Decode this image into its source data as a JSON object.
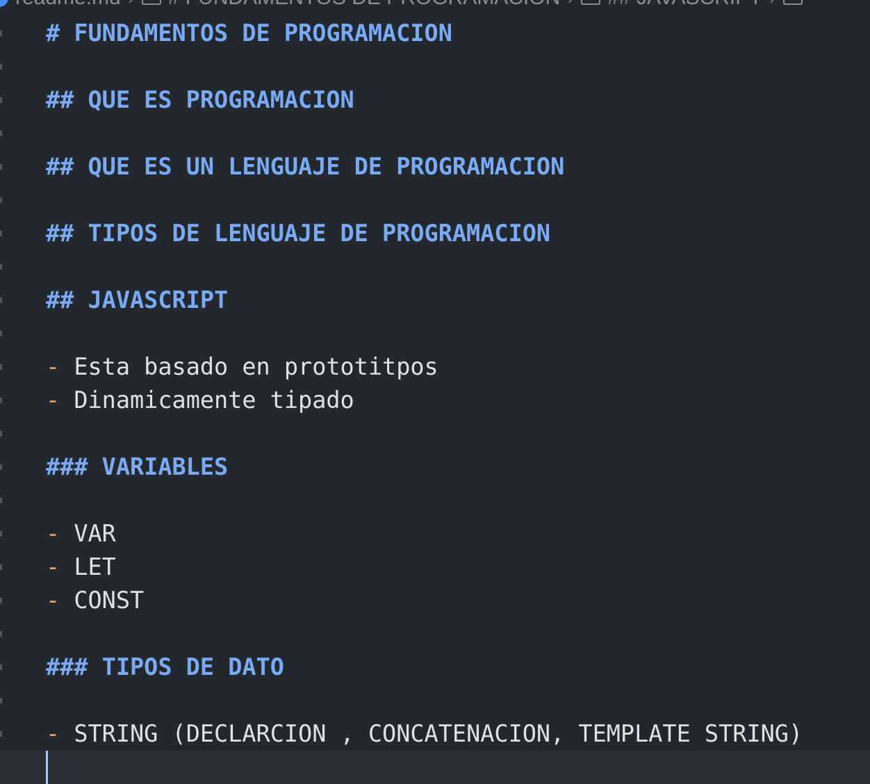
{
  "breadcrumb": {
    "file": "readme.md",
    "items": [
      "# FUNDAMENTOS DE PROGRAMACION",
      "## JAVASCRIPT"
    ]
  },
  "lines": [
    {
      "type": "heading",
      "text": "# FUNDAMENTOS DE PROGRAMACION"
    },
    {
      "type": "empty",
      "text": ""
    },
    {
      "type": "heading",
      "text": "## QUE ES PROGRAMACION"
    },
    {
      "type": "empty",
      "text": ""
    },
    {
      "type": "heading",
      "text": "## QUE ES UN LENGUAJE DE PROGRAMACION"
    },
    {
      "type": "empty",
      "text": ""
    },
    {
      "type": "heading",
      "text": "## TIPOS DE LENGUAJE DE PROGRAMACION"
    },
    {
      "type": "empty",
      "text": ""
    },
    {
      "type": "heading",
      "text": "## JAVASCRIPT"
    },
    {
      "type": "empty",
      "text": ""
    },
    {
      "type": "list",
      "bullet": "-",
      "text": "Esta basado en prototitpos"
    },
    {
      "type": "list",
      "bullet": "-",
      "text": "Dinamicamente tipado"
    },
    {
      "type": "empty",
      "text": ""
    },
    {
      "type": "heading",
      "text": "### VARIABLES"
    },
    {
      "type": "empty",
      "text": ""
    },
    {
      "type": "list",
      "bullet": "-",
      "text": "VAR"
    },
    {
      "type": "list",
      "bullet": "-",
      "text": "LET"
    },
    {
      "type": "list",
      "bullet": "-",
      "text": "CONST"
    },
    {
      "type": "empty",
      "text": ""
    },
    {
      "type": "heading",
      "text": "### TIPOS DE DATO"
    },
    {
      "type": "empty",
      "text": ""
    },
    {
      "type": "list",
      "bullet": "-",
      "text": "STRING (DECLARCION , CONCATENACION, TEMPLATE STRING)"
    },
    {
      "type": "current",
      "text": ""
    }
  ],
  "colors": {
    "heading": "#79aaf3",
    "bullet": "#e8a26a",
    "text": "#dfe1e5",
    "background": "#23272e"
  }
}
